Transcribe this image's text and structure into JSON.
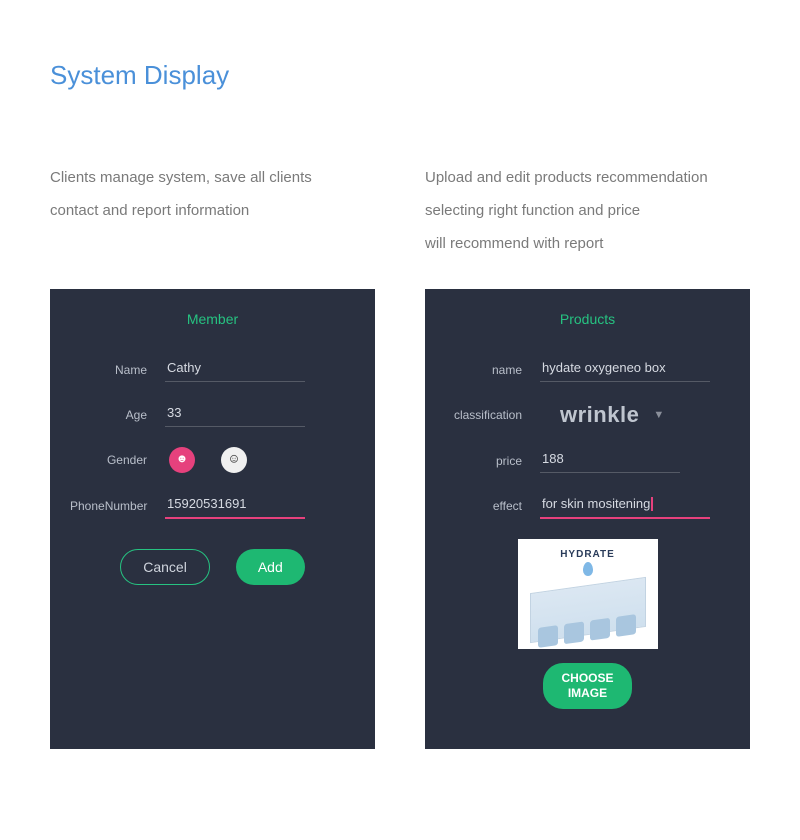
{
  "title": "System Display",
  "left": {
    "desc_line1": "Clients manage system, save all clients",
    "desc_line2": "contact and report information",
    "panel_title": "Member",
    "labels": {
      "name": "Name",
      "age": "Age",
      "gender": "Gender",
      "phone": "PhoneNumber"
    },
    "values": {
      "name": "Cathy",
      "age": "33",
      "phone": "15920531691"
    },
    "buttons": {
      "cancel": "Cancel",
      "add": "Add"
    }
  },
  "right": {
    "desc_line1": "Upload and edit products recommendation",
    "desc_line2": "selecting right function and price",
    "desc_line3": "will recommend with report",
    "panel_title": "Products",
    "labels": {
      "name": "name",
      "classification": "classification",
      "price": "price",
      "effect": "effect"
    },
    "values": {
      "name": "hydate oxygeneo box",
      "classification": "wrinkle",
      "price": "188",
      "effect": "for skin mositening"
    },
    "image_brand": "HYDRATE",
    "buttons": {
      "choose": "CHOOSE IMAGE"
    }
  }
}
